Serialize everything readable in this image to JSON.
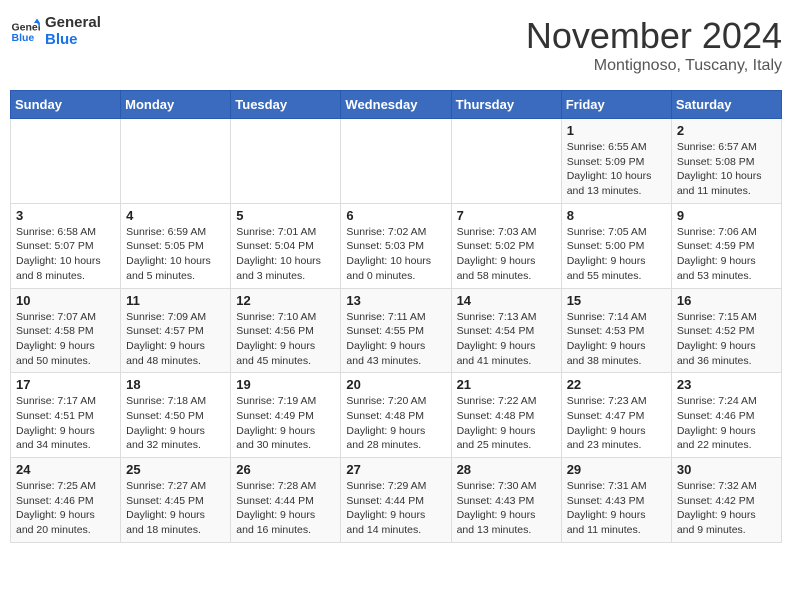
{
  "logo": {
    "line1": "General",
    "line2": "Blue"
  },
  "title": "November 2024",
  "location": "Montignoso, Tuscany, Italy",
  "weekdays": [
    "Sunday",
    "Monday",
    "Tuesday",
    "Wednesday",
    "Thursday",
    "Friday",
    "Saturday"
  ],
  "weeks": [
    [
      {
        "day": "",
        "info": ""
      },
      {
        "day": "",
        "info": ""
      },
      {
        "day": "",
        "info": ""
      },
      {
        "day": "",
        "info": ""
      },
      {
        "day": "",
        "info": ""
      },
      {
        "day": "1",
        "info": "Sunrise: 6:55 AM\nSunset: 5:09 PM\nDaylight: 10 hours and 13 minutes."
      },
      {
        "day": "2",
        "info": "Sunrise: 6:57 AM\nSunset: 5:08 PM\nDaylight: 10 hours and 11 minutes."
      }
    ],
    [
      {
        "day": "3",
        "info": "Sunrise: 6:58 AM\nSunset: 5:07 PM\nDaylight: 10 hours and 8 minutes."
      },
      {
        "day": "4",
        "info": "Sunrise: 6:59 AM\nSunset: 5:05 PM\nDaylight: 10 hours and 5 minutes."
      },
      {
        "day": "5",
        "info": "Sunrise: 7:01 AM\nSunset: 5:04 PM\nDaylight: 10 hours and 3 minutes."
      },
      {
        "day": "6",
        "info": "Sunrise: 7:02 AM\nSunset: 5:03 PM\nDaylight: 10 hours and 0 minutes."
      },
      {
        "day": "7",
        "info": "Sunrise: 7:03 AM\nSunset: 5:02 PM\nDaylight: 9 hours and 58 minutes."
      },
      {
        "day": "8",
        "info": "Sunrise: 7:05 AM\nSunset: 5:00 PM\nDaylight: 9 hours and 55 minutes."
      },
      {
        "day": "9",
        "info": "Sunrise: 7:06 AM\nSunset: 4:59 PM\nDaylight: 9 hours and 53 minutes."
      }
    ],
    [
      {
        "day": "10",
        "info": "Sunrise: 7:07 AM\nSunset: 4:58 PM\nDaylight: 9 hours and 50 minutes."
      },
      {
        "day": "11",
        "info": "Sunrise: 7:09 AM\nSunset: 4:57 PM\nDaylight: 9 hours and 48 minutes."
      },
      {
        "day": "12",
        "info": "Sunrise: 7:10 AM\nSunset: 4:56 PM\nDaylight: 9 hours and 45 minutes."
      },
      {
        "day": "13",
        "info": "Sunrise: 7:11 AM\nSunset: 4:55 PM\nDaylight: 9 hours and 43 minutes."
      },
      {
        "day": "14",
        "info": "Sunrise: 7:13 AM\nSunset: 4:54 PM\nDaylight: 9 hours and 41 minutes."
      },
      {
        "day": "15",
        "info": "Sunrise: 7:14 AM\nSunset: 4:53 PM\nDaylight: 9 hours and 38 minutes."
      },
      {
        "day": "16",
        "info": "Sunrise: 7:15 AM\nSunset: 4:52 PM\nDaylight: 9 hours and 36 minutes."
      }
    ],
    [
      {
        "day": "17",
        "info": "Sunrise: 7:17 AM\nSunset: 4:51 PM\nDaylight: 9 hours and 34 minutes."
      },
      {
        "day": "18",
        "info": "Sunrise: 7:18 AM\nSunset: 4:50 PM\nDaylight: 9 hours and 32 minutes."
      },
      {
        "day": "19",
        "info": "Sunrise: 7:19 AM\nSunset: 4:49 PM\nDaylight: 9 hours and 30 minutes."
      },
      {
        "day": "20",
        "info": "Sunrise: 7:20 AM\nSunset: 4:48 PM\nDaylight: 9 hours and 28 minutes."
      },
      {
        "day": "21",
        "info": "Sunrise: 7:22 AM\nSunset: 4:48 PM\nDaylight: 9 hours and 25 minutes."
      },
      {
        "day": "22",
        "info": "Sunrise: 7:23 AM\nSunset: 4:47 PM\nDaylight: 9 hours and 23 minutes."
      },
      {
        "day": "23",
        "info": "Sunrise: 7:24 AM\nSunset: 4:46 PM\nDaylight: 9 hours and 22 minutes."
      }
    ],
    [
      {
        "day": "24",
        "info": "Sunrise: 7:25 AM\nSunset: 4:46 PM\nDaylight: 9 hours and 20 minutes."
      },
      {
        "day": "25",
        "info": "Sunrise: 7:27 AM\nSunset: 4:45 PM\nDaylight: 9 hours and 18 minutes."
      },
      {
        "day": "26",
        "info": "Sunrise: 7:28 AM\nSunset: 4:44 PM\nDaylight: 9 hours and 16 minutes."
      },
      {
        "day": "27",
        "info": "Sunrise: 7:29 AM\nSunset: 4:44 PM\nDaylight: 9 hours and 14 minutes."
      },
      {
        "day": "28",
        "info": "Sunrise: 7:30 AM\nSunset: 4:43 PM\nDaylight: 9 hours and 13 minutes."
      },
      {
        "day": "29",
        "info": "Sunrise: 7:31 AM\nSunset: 4:43 PM\nDaylight: 9 hours and 11 minutes."
      },
      {
        "day": "30",
        "info": "Sunrise: 7:32 AM\nSunset: 4:42 PM\nDaylight: 9 hours and 9 minutes."
      }
    ]
  ]
}
